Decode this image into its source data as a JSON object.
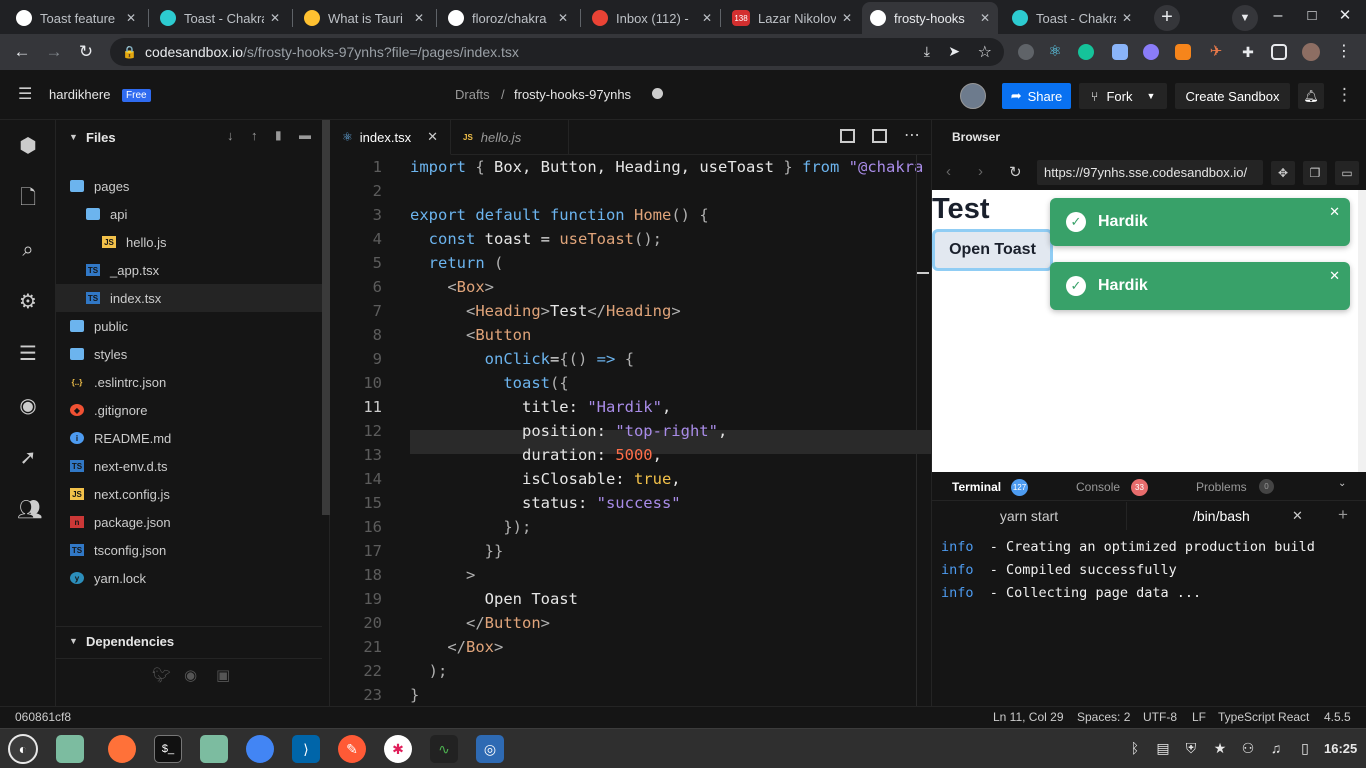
{
  "chrome": {
    "tabs": [
      {
        "title": "Toast feature",
        "icon": "github-icon",
        "color": "#ffffff"
      },
      {
        "title": "Toast - Chakra",
        "icon": "chakra-icon",
        "color": "#2dcbd0"
      },
      {
        "title": "What is Tauri",
        "icon": "tauri-icon",
        "color": "#ffc131"
      },
      {
        "title": "floroz/chakra",
        "icon": "github-icon",
        "color": "#ffffff"
      },
      {
        "title": "Inbox (112) - ",
        "icon": "gmail-icon",
        "color": "#ea4335"
      },
      {
        "title": "Lazar Nikolov",
        "icon": "youtube-badge-icon",
        "color": "#d32f2f",
        "badge": "138"
      },
      {
        "title": "frosty-hooks",
        "icon": "codesandbox-icon",
        "color": "#ffffff"
      },
      {
        "title": "Toast - Chakra",
        "icon": "chakra-icon",
        "color": "#2dcbd0"
      }
    ],
    "url_host": "codesandbox.io",
    "url_path": "/s/frosty-hooks-97ynhs?file=/pages/index.tsx"
  },
  "header": {
    "user": "hardikhere",
    "plan": "Free",
    "breadcrumb_root": "Drafts",
    "breadcrumb_sep": "/",
    "sandbox_name": "frosty-hooks-97ynhs",
    "share": "Share",
    "fork": "Fork",
    "create": "Create Sandbox"
  },
  "explorer": {
    "title": "Files",
    "files": [
      {
        "name": "pages",
        "type": "folder",
        "indent": 0
      },
      {
        "name": "api",
        "type": "folder",
        "indent": 1
      },
      {
        "name": "hello.js",
        "type": "js",
        "indent": 2
      },
      {
        "name": "_app.tsx",
        "type": "ts",
        "indent": 1
      },
      {
        "name": "index.tsx",
        "type": "ts",
        "indent": 1,
        "selected": true
      },
      {
        "name": "public",
        "type": "folder",
        "indent": 0
      },
      {
        "name": "styles",
        "type": "folder",
        "indent": 0
      },
      {
        "name": ".eslintrc.json",
        "type": "json",
        "indent": 0
      },
      {
        "name": ".gitignore",
        "type": "git",
        "indent": 0
      },
      {
        "name": "README.md",
        "type": "info",
        "indent": 0
      },
      {
        "name": "next-env.d.ts",
        "type": "ts",
        "indent": 0
      },
      {
        "name": "next.config.js",
        "type": "js",
        "indent": 0
      },
      {
        "name": "package.json",
        "type": "npm",
        "indent": 0
      },
      {
        "name": "tsconfig.json",
        "type": "ts",
        "indent": 0
      },
      {
        "name": "yarn.lock",
        "type": "yarn",
        "indent": 0
      }
    ],
    "dependencies": "Dependencies"
  },
  "editor": {
    "tabs": [
      {
        "name": "index.tsx",
        "badge": "⚛",
        "active": true
      },
      {
        "name": "hello.js",
        "badge": "JS",
        "active": false
      }
    ],
    "current_line": 11
  },
  "browser": {
    "title": "Browser",
    "url": "https://97ynhs.sse.codesandbox.io/",
    "heading": "Test",
    "button": "Open Toast",
    "toasts": [
      {
        "title": "Hardik"
      },
      {
        "title": "Hardik"
      }
    ]
  },
  "terminal": {
    "tabs": [
      {
        "name": "Terminal",
        "count": "127",
        "color": "#4d9bf0"
      },
      {
        "name": "Console",
        "count": "33",
        "color": "#e86c6c"
      },
      {
        "name": "Problems",
        "count": "0",
        "color": "#444444"
      }
    ],
    "sessions": [
      "yarn start",
      "/bin/bash"
    ],
    "lines": [
      {
        "level": "info",
        "text": "- Creating an optimized production build"
      },
      {
        "level": "info",
        "text": "- Compiled successfully"
      },
      {
        "level": "info",
        "text": "- Collecting page data ..."
      }
    ]
  },
  "status": {
    "commit": "060861cf8",
    "position": "Ln 11, Col 29",
    "spaces": "Spaces: 2",
    "encoding": "UTF-8",
    "eol": "LF",
    "language": "TypeScript React",
    "version": "4.5.5"
  },
  "taskbar": {
    "time": "16:25"
  }
}
